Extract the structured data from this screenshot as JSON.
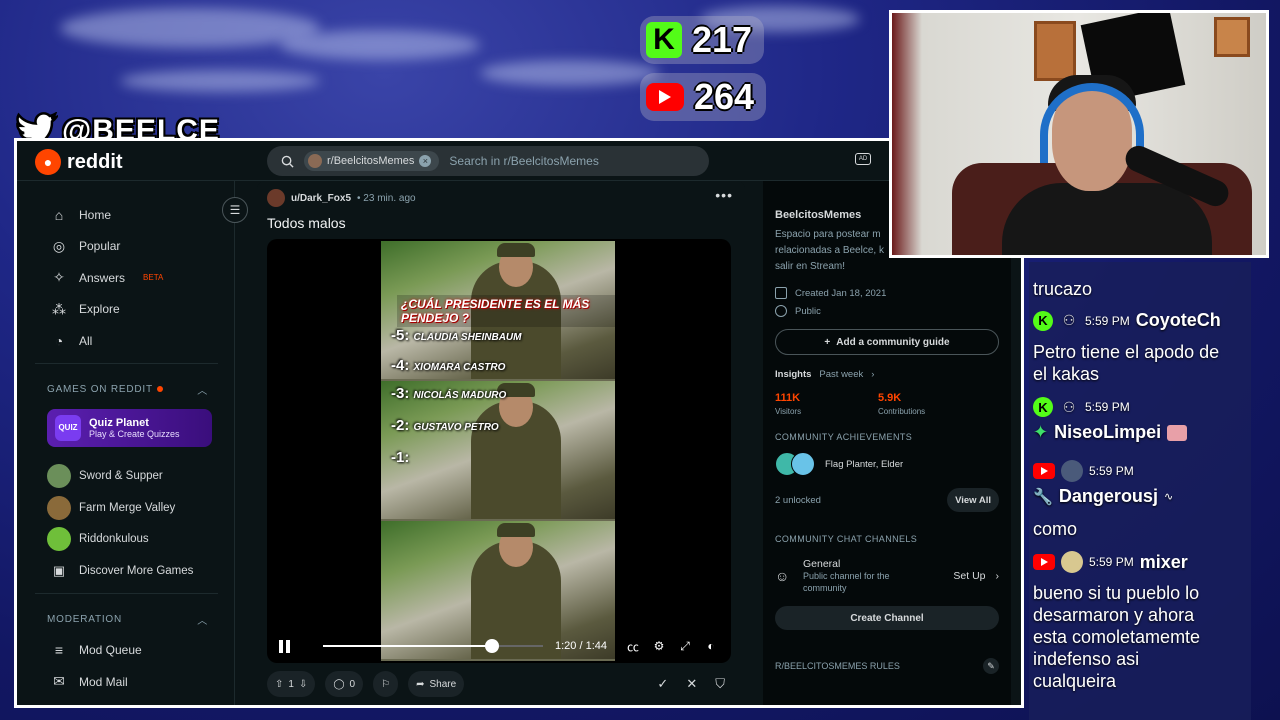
{
  "overlay": {
    "twitter_handle": "@BEELCE_",
    "kick_viewers": "217",
    "youtube_viewers": "264"
  },
  "reddit": {
    "logo_text": "reddit",
    "search": {
      "community_chip": "r/BeelcitosMemes",
      "placeholder": "Search in r/BeelcitosMemes"
    },
    "sidebar": {
      "nav": [
        {
          "label": "Home",
          "icon": "home-icon"
        },
        {
          "label": "Popular",
          "icon": "popular-icon"
        },
        {
          "label": "Answers",
          "icon": "answers-icon",
          "badge": "BETA"
        },
        {
          "label": "Explore",
          "icon": "explore-icon"
        },
        {
          "label": "All",
          "icon": "all-icon"
        }
      ],
      "games_heading": "GAMES ON REDDIT",
      "quiz": {
        "title": "Quiz Planet",
        "subtitle": "Play & Create Quizzes",
        "icon_text": "QUIZ"
      },
      "games": [
        {
          "label": "Sword & Supper",
          "color": "#6b8f5a"
        },
        {
          "label": "Farm Merge Valley",
          "color": "#8a6a3a"
        },
        {
          "label": "Riddonkulous",
          "color": "#6fbf3a"
        },
        {
          "label": "Discover More Games",
          "icon": "gamepad-icon"
        }
      ],
      "moderation_heading": "MODERATION",
      "moderation": [
        {
          "label": "Mod Queue",
          "icon": "queue-icon"
        },
        {
          "label": "Mod Mail",
          "icon": "mail-icon"
        }
      ]
    },
    "post": {
      "author": "u/Dark_Fox5",
      "time": "• 23 min. ago",
      "title": "Todos malos",
      "video": {
        "headline": "¿CUÁL PRESIDENTE ES EL MÁS PENDEJO ?",
        "ranks": [
          {
            "num": "-5:",
            "name": "CLAUDIA SHEINBAUM"
          },
          {
            "num": "-4:",
            "name": "XIOMARA CASTRO"
          },
          {
            "num": "-3:",
            "name": "NICOLÁS MADURO"
          },
          {
            "num": "-2:",
            "name": "GUSTAVO PETRO"
          },
          {
            "num": "-1:",
            "name": ""
          }
        ],
        "time": "1:20 / 1:44",
        "progress": 0.77
      },
      "votes": "1",
      "comments": "0",
      "share": "Share"
    },
    "community": {
      "name": "BeelcitosMemes",
      "description_lines": [
        "Espacio para postear m",
        "relacionadas a Beelce, k",
        "salir en Stream!"
      ],
      "created": "Created Jan 18, 2021",
      "visibility": "Public",
      "guide_button": "Add a community guide",
      "insights_label": "Insights",
      "insights_period": "Past week",
      "visitors": "111K",
      "visitors_label": "Visitors",
      "contributions": "5.9K",
      "contributions_label": "Contributions",
      "achievements_heading": "COMMUNITY ACHIEVEMENTS",
      "achievements_text": "Flag Planter, Elder",
      "unlocked": "2 unlocked",
      "view_all": "View All",
      "chat_heading": "COMMUNITY CHAT CHANNELS",
      "channel_name": "General",
      "channel_desc_1": "Public channel for the",
      "channel_desc_2": "community",
      "setup": "Set Up",
      "create_channel": "Create Channel",
      "rules_heading": "R/BEELCITOSMEMES RULES"
    }
  },
  "chat": [
    {
      "type": "text",
      "text": "trucazo"
    },
    {
      "type": "meta",
      "platform": "kick",
      "time": "5:59 PM",
      "user": "CoyoteCh"
    },
    {
      "type": "text",
      "text": "Petro tiene el apodo de"
    },
    {
      "type": "text",
      "text": "el kakas"
    },
    {
      "type": "meta",
      "platform": "kick",
      "time": "5:59 PM",
      "user": ""
    },
    {
      "type": "user",
      "user": "NiseoLimpei"
    },
    {
      "type": "meta",
      "platform": "youtube",
      "time": "5:59 PM",
      "user": ""
    },
    {
      "type": "user",
      "user": "Dangerousj"
    },
    {
      "type": "text",
      "text": "como"
    },
    {
      "type": "meta",
      "platform": "youtube",
      "time": "5:59 PM",
      "user": "mixer"
    },
    {
      "type": "text",
      "text": "bueno si tu pueblo lo"
    },
    {
      "type": "text",
      "text": "desarmaron y ahora"
    },
    {
      "type": "text",
      "text": "esta comoletamemte"
    },
    {
      "type": "text",
      "text": "indefenso asi"
    },
    {
      "type": "text",
      "text": "cualqueira"
    }
  ]
}
